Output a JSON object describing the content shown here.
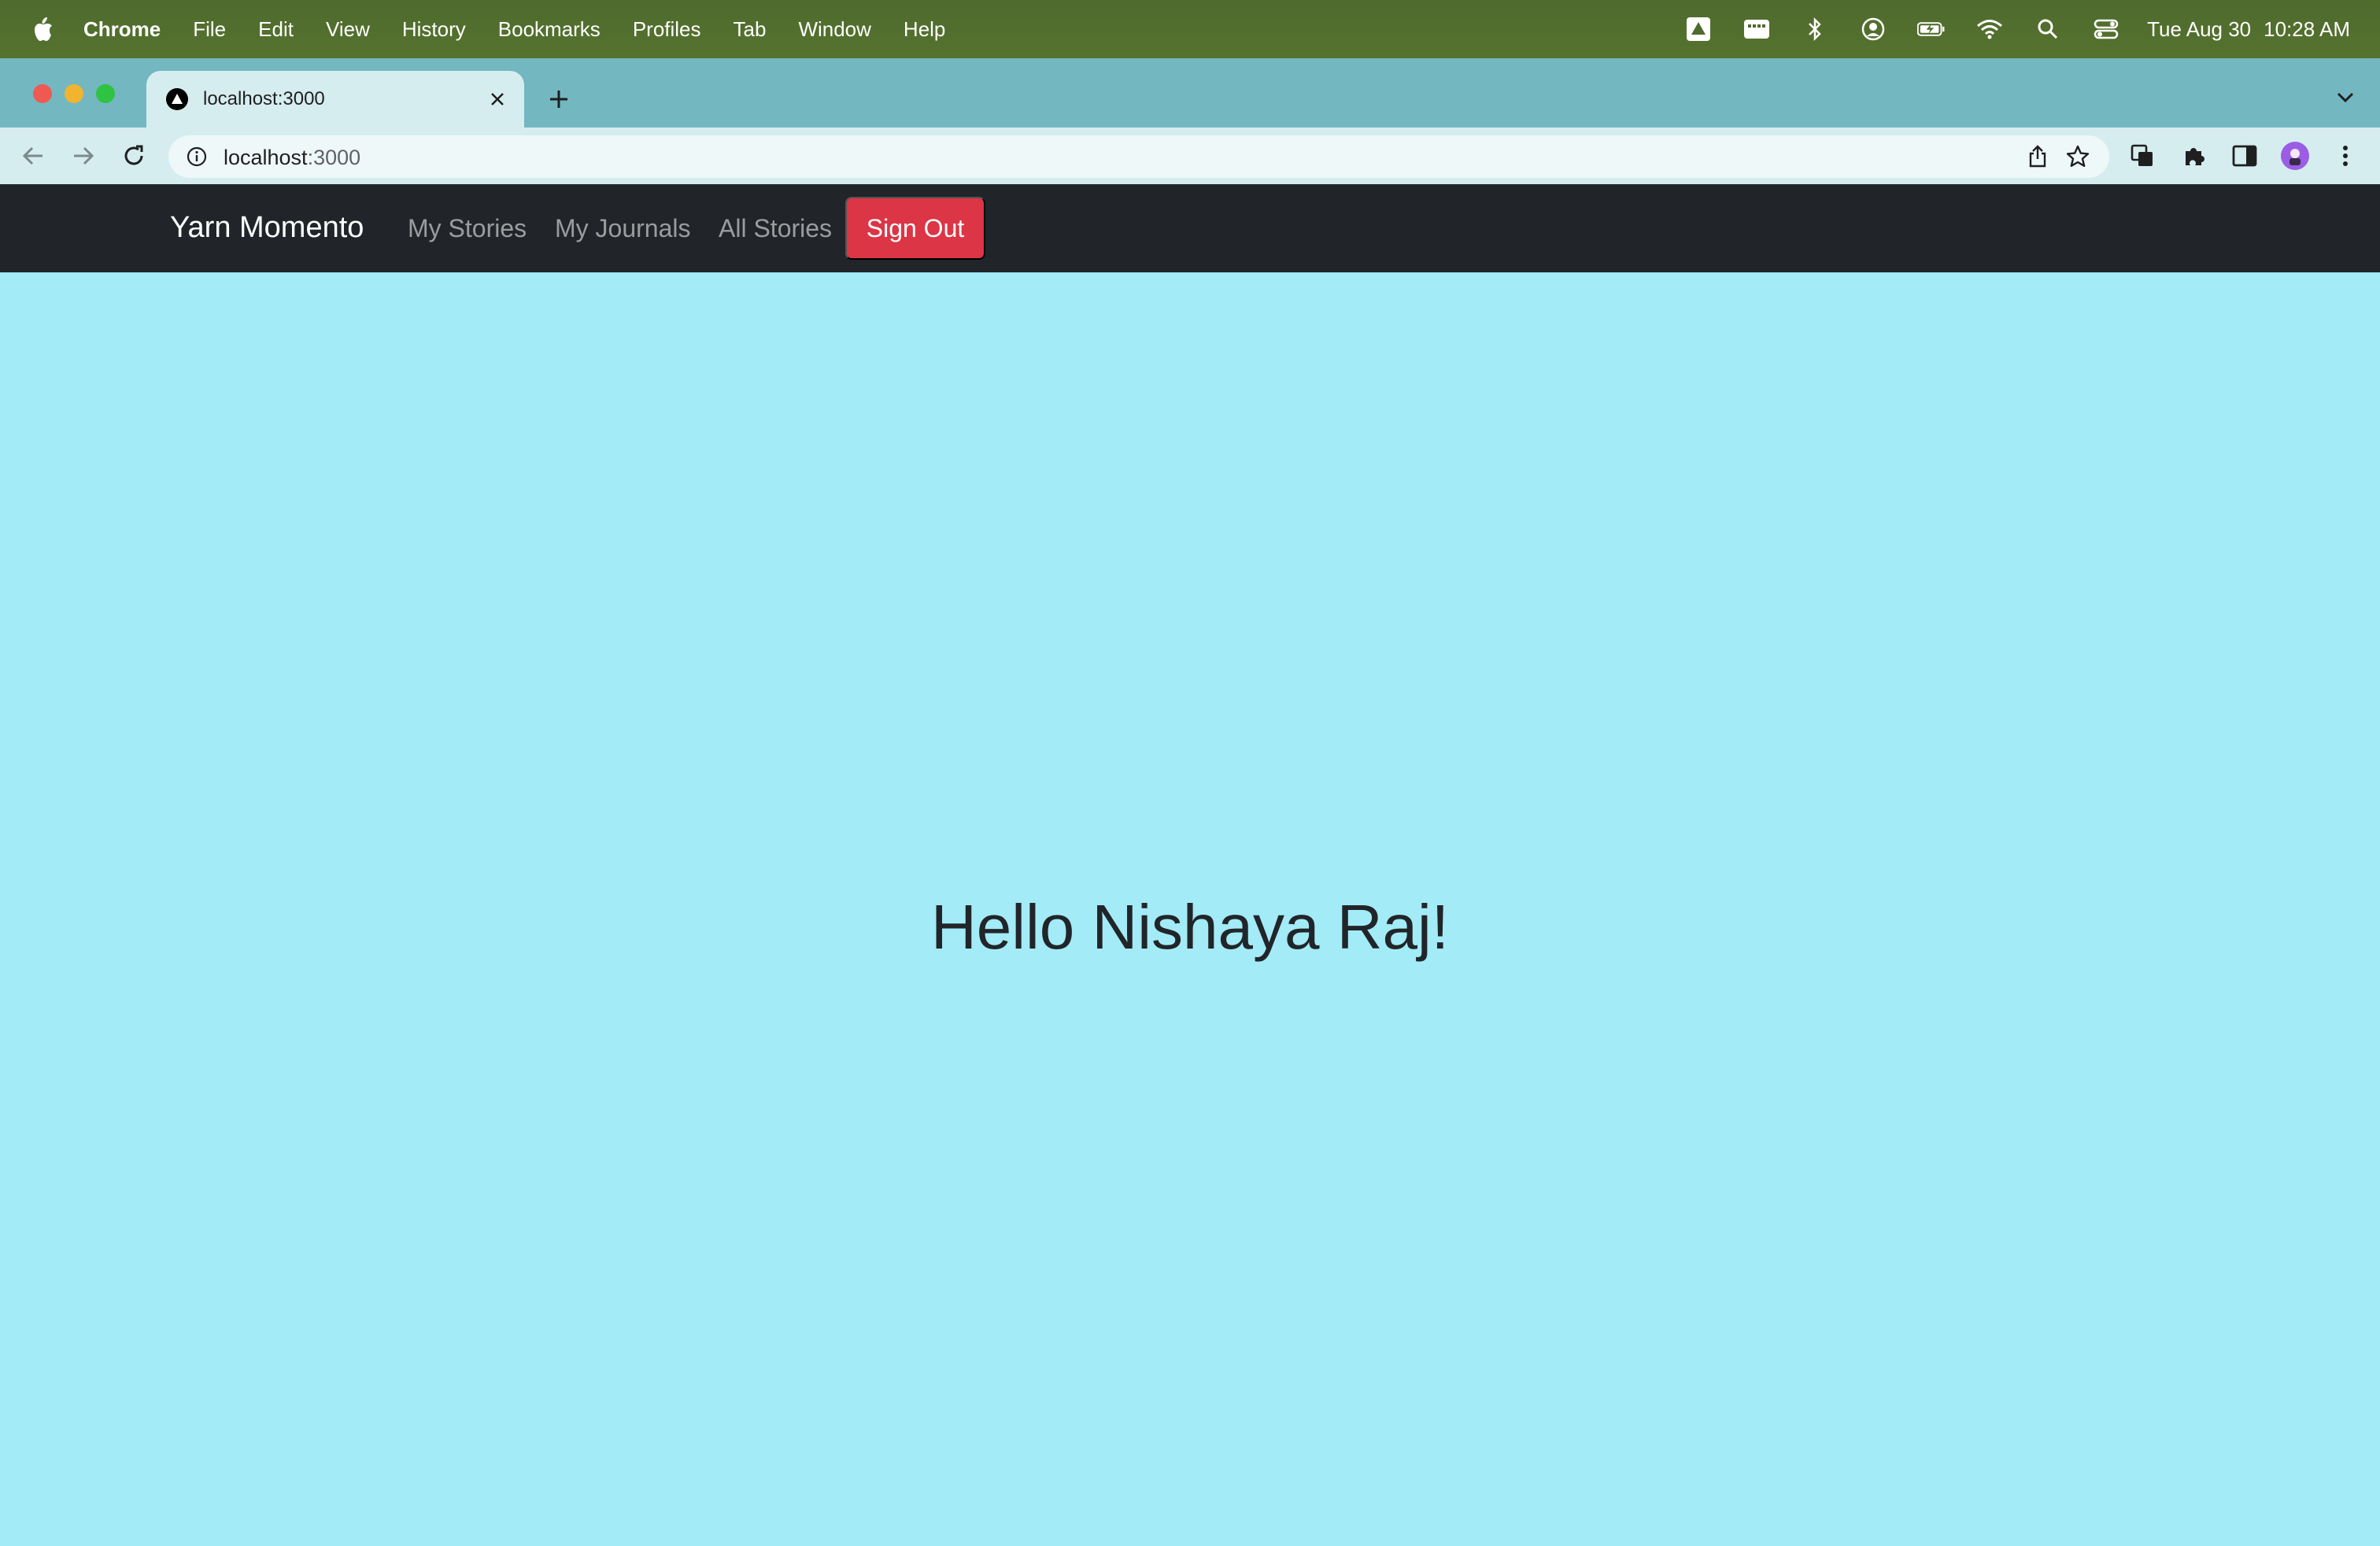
{
  "menubar": {
    "items": [
      "Chrome",
      "File",
      "Edit",
      "View",
      "History",
      "Bookmarks",
      "Profiles",
      "Tab",
      "Window",
      "Help"
    ],
    "date": "Tue Aug 30",
    "time": "10:28 AM"
  },
  "browser": {
    "tab_title": "localhost:3000",
    "url_host": "localhost",
    "url_port": ":3000"
  },
  "navbar": {
    "brand": "Yarn Momento",
    "links": [
      "My Stories",
      "My Journals",
      "All Stories"
    ],
    "sign_out": "Sign Out"
  },
  "main": {
    "greeting": "Hello Nishaya Raj!"
  },
  "colors": {
    "page_background": "#a2ebf7",
    "navbar_background": "#212529",
    "sign_out_button": "#dc3545"
  }
}
